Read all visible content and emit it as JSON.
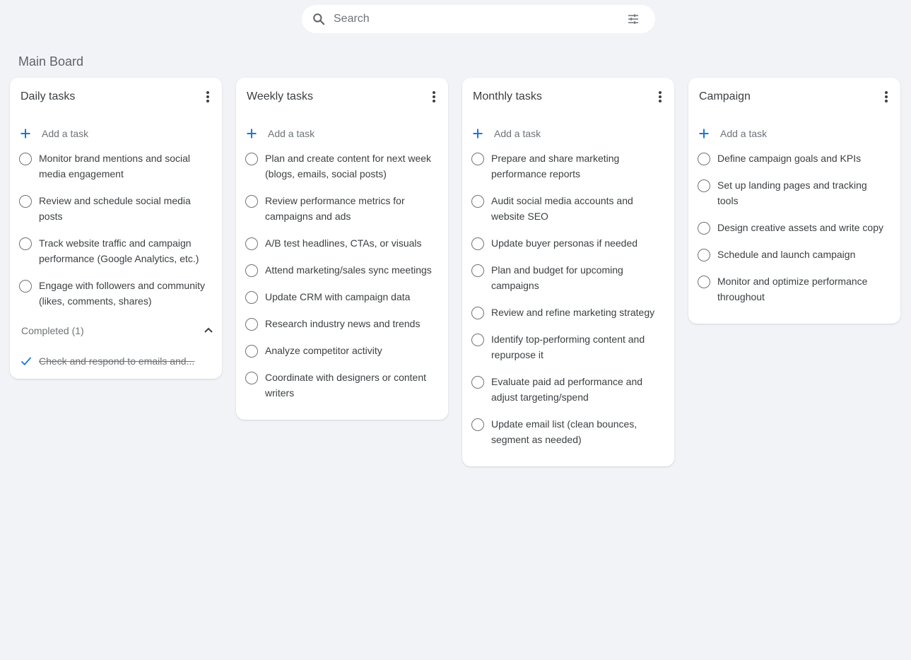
{
  "search": {
    "placeholder": "Search",
    "icon": "search-icon",
    "filter_icon": "tune-icon"
  },
  "board": {
    "title": "Main Board"
  },
  "colors": {
    "accent": "#1a73e8",
    "background": "#f1f3f7",
    "card": "#ffffff"
  },
  "lists": [
    {
      "title": "Daily tasks",
      "add_label": "Add a task",
      "tasks": [
        "Monitor brand mentions and social media engagement",
        "Review and schedule social media posts",
        "Track website traffic and campaign performance (Google Analytics, etc.)",
        "Engage with followers and community (likes, comments, shares)"
      ],
      "completed_label": "Completed (1)",
      "completed": [
        "Check and respond to emails and..."
      ]
    },
    {
      "title": "Weekly tasks",
      "add_label": "Add a task",
      "tasks": [
        "Plan and create content for next week (blogs, emails, social posts)",
        "Review performance metrics for campaigns and ads",
        "A/B test headlines, CTAs, or visuals",
        "Attend marketing/sales sync meetings",
        "Update CRM with campaign data",
        "Research industry news and trends",
        "Analyze competitor activity",
        "Coordinate with designers or content writers"
      ]
    },
    {
      "title": "Monthly tasks",
      "add_label": "Add a task",
      "tasks": [
        "Prepare and share marketing performance reports",
        "Audit social media accounts and website SEO",
        "Update buyer personas if needed",
        "Plan and budget for upcoming campaigns",
        "Review and refine marketing strategy",
        "Identify top-performing content and repurpose it",
        "Evaluate paid ad performance and adjust targeting/spend",
        "Update email list (clean bounces, segment as needed)"
      ]
    },
    {
      "title": "Campaign",
      "add_label": "Add a task",
      "tasks": [
        "Define campaign goals and KPIs",
        "Set up landing pages and tracking tools",
        "Design creative assets and write copy",
        "Schedule and launch campaign",
        "Monitor and optimize performance throughout"
      ]
    }
  ]
}
